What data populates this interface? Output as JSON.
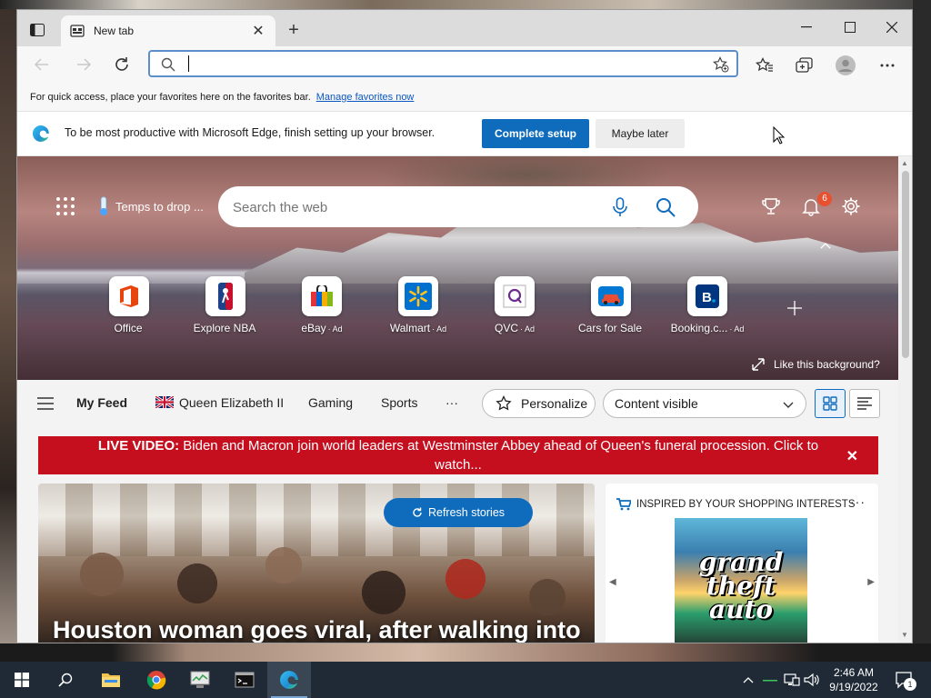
{
  "tab": {
    "title": "New tab"
  },
  "window_controls": {
    "minimize": "—",
    "maximize": "☐",
    "close": "✕"
  },
  "address_bar": {
    "value": "",
    "placeholder": ""
  },
  "favorites_bar": {
    "message": "For quick access, place your favorites here on the favorites bar.",
    "link": "Manage favorites now"
  },
  "infobar": {
    "message": "To be most productive with Microsoft Edge, finish setting up your browser.",
    "primary_button": "Complete setup",
    "secondary_button": "Maybe later"
  },
  "hero": {
    "weather": "Temps to drop ...",
    "search_placeholder": "Search the web",
    "notification_count": "6",
    "like_background": "Like this background?"
  },
  "quick_links": [
    {
      "label": "Office",
      "ad": ""
    },
    {
      "label": "Explore NBA",
      "ad": ""
    },
    {
      "label": "eBay",
      "ad": "· Ad"
    },
    {
      "label": "Walmart",
      "ad": "· Ad"
    },
    {
      "label": "QVC",
      "ad": "· Ad"
    },
    {
      "label": "Cars for Sale",
      "ad": ""
    },
    {
      "label": "Booking.c...",
      "ad": "· Ad"
    }
  ],
  "feed_nav": {
    "items": [
      "My Feed",
      "Queen Elizabeth II",
      "Gaming",
      "Sports",
      "···"
    ],
    "personalize": "Personalize",
    "content_visibility": "Content visible"
  },
  "live_banner": {
    "prefix": "LIVE VIDEO:",
    "text": "Biden and Macron join world leaders at Westminster Abbey ahead of Queen's funeral procession. Click to watch...",
    "close": "✕"
  },
  "story": {
    "refresh_label": "Refresh stories",
    "headline": "Houston woman goes viral, after walking into"
  },
  "shopping": {
    "heading": "INSPIRED BY YOUR SHOPPING INTERESTS",
    "more": "···",
    "product_text": "grand theft auto"
  },
  "taskbar": {
    "time": "2:46 AM",
    "date": "9/19/2022",
    "notification_count": "1"
  },
  "colors": {
    "accent": "#0f6cbd",
    "live_red": "#c50f1f",
    "taskbar": "#1f2a36",
    "badge": "#e8502f"
  }
}
